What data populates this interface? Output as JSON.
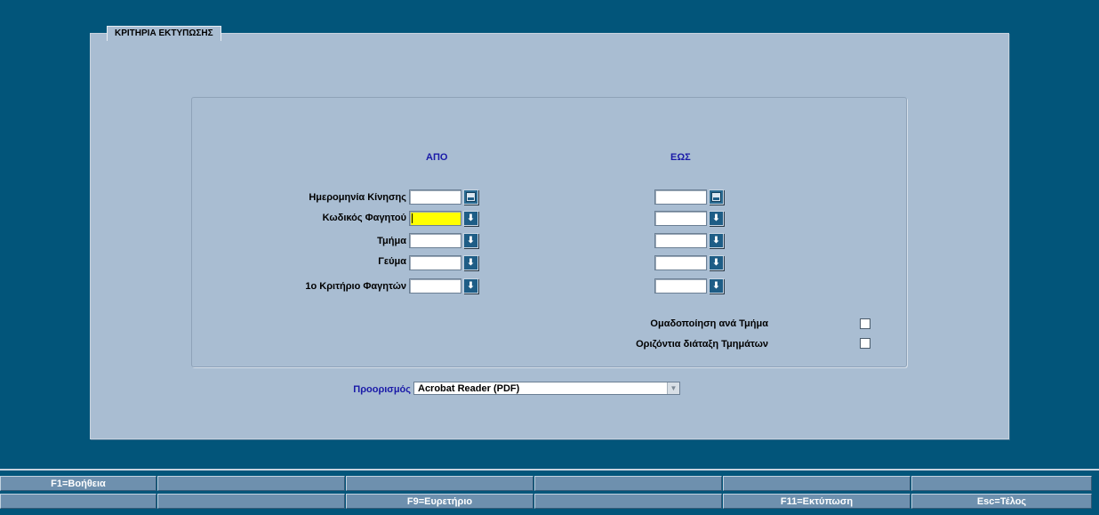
{
  "panel": {
    "title": "ΚΡΙΤΗΡΙΑ ΕΚΤΥΠΩΣΗΣ"
  },
  "criteria": {
    "from_header": "ΑΠΟ",
    "to_header": "ΕΩΣ",
    "rows": [
      {
        "label": "Ημερομηνία Κίνησης",
        "from_value": "",
        "to_value": "",
        "button_icon": "calendar-icon"
      },
      {
        "label": "Κωδικός Φαγητού",
        "from_value": "",
        "to_value": "",
        "button_icon": "arrow-down-icon"
      },
      {
        "label": "Τμήμα",
        "from_value": "",
        "to_value": "",
        "button_icon": "arrow-down-icon"
      },
      {
        "label": "Γεύμα",
        "from_value": "",
        "to_value": "",
        "button_icon": "arrow-down-icon"
      },
      {
        "label": "1ο Κριτήριο Φαγητών",
        "from_value": "",
        "to_value": "",
        "button_icon": "arrow-down-icon"
      }
    ],
    "active_field_color": "#ffff00"
  },
  "options": {
    "group_by_dept": {
      "label": "Ομαδοποίηση ανά Τμήμα",
      "checked": false
    },
    "horizontal_layout": {
      "label": "Οριζόντια διάταξη Τμημάτων",
      "checked": false
    }
  },
  "destination": {
    "label": "Προορισμός",
    "selected": "Acrobat Reader (PDF)"
  },
  "function_keys": {
    "row1": [
      "F1=Βοήθεια",
      "",
      "",
      "",
      "",
      ""
    ],
    "row2": [
      "",
      "",
      "F9=Ευρετήριο",
      "",
      "F11=Εκτύπωση",
      "Esc=Τέλος"
    ]
  },
  "colors": {
    "background": "#02557a",
    "panel": "#a9bdd2",
    "accent_text": "#1a1aa8",
    "function_key": "#6e90ae"
  }
}
